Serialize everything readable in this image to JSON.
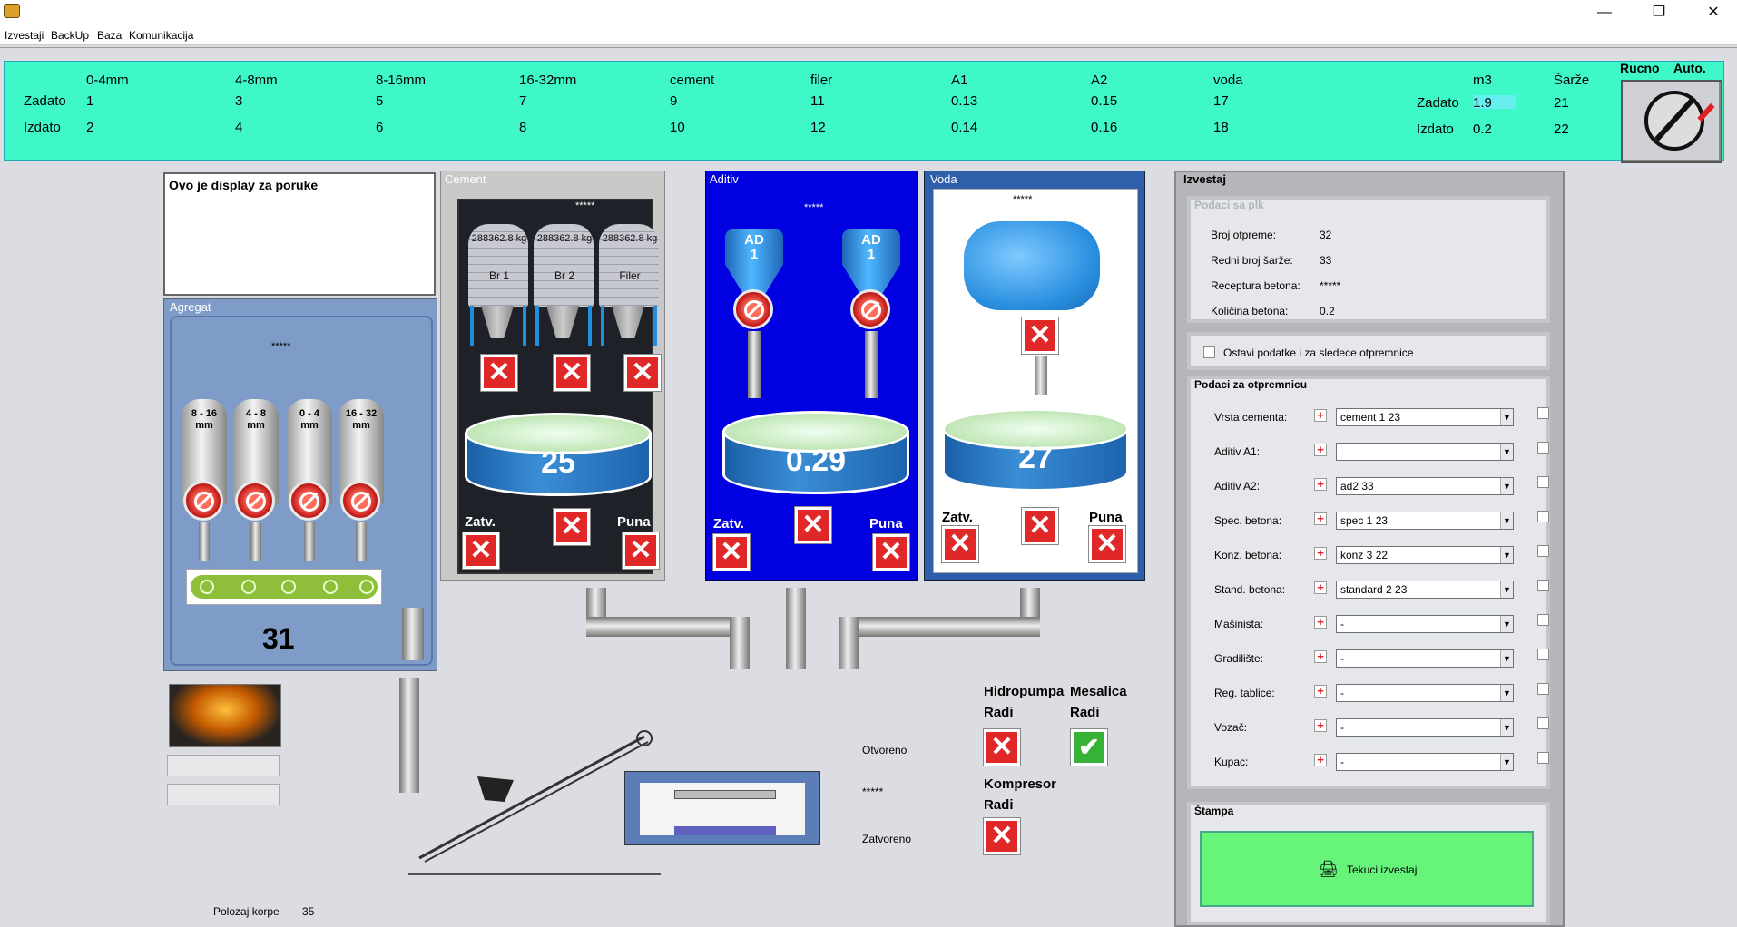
{
  "window": {
    "minimize": "—",
    "maximize": "❐",
    "close": "✕"
  },
  "menu": [
    "Izvestaji",
    "BackUp",
    "Baza",
    "Komunikacija"
  ],
  "top": {
    "columns": [
      "0-4mm",
      "4-8mm",
      "8-16mm",
      "16-32mm",
      "cement",
      "filer",
      "A1",
      "A2",
      "voda"
    ],
    "row_labels": {
      "zadato": "Zadato",
      "izdato": "Izdato"
    },
    "zadato": [
      "1",
      "3",
      "5",
      "7",
      "9",
      "11",
      "0.13",
      "0.15",
      "17"
    ],
    "izdato": [
      "2",
      "4",
      "6",
      "8",
      "10",
      "12",
      "0.14",
      "0.16",
      "18"
    ],
    "m3_label": "m3",
    "sarze_label": "Šarže",
    "m3_zadato": "1.9",
    "m3_izdato": "0.2",
    "sarze_zadato": "21",
    "sarze_izdato": "22",
    "ruc": "Rucno",
    "aut": "Auto."
  },
  "message": "Ovo je display za  poruke",
  "agregat": {
    "title": "Agregat",
    "stars": "*****",
    "silos": [
      "8 - 16\nmm",
      "4 - 8\nmm",
      "0 - 4\nmm",
      "16 - 32\nmm"
    ],
    "count": "31"
  },
  "cement": {
    "title": "Cement",
    "stars": "*****",
    "silos": [
      {
        "kg": "288362.8 kg",
        "name": "Br 1"
      },
      {
        "kg": "288362.8 kg",
        "name": "Br 2"
      },
      {
        "kg": "288362.8 kg",
        "name": "Filer"
      }
    ],
    "value": "25",
    "zatv": "Zatv.",
    "puna": "Puna"
  },
  "aditiv": {
    "title": "Aditiv",
    "stars": "*****",
    "ad1": "AD\n1",
    "ad2": "AD\n1",
    "value": "0.29",
    "zatv": "Zatv.",
    "puna": "Puna"
  },
  "voda": {
    "title": "Voda",
    "stars": "*****",
    "value": "27",
    "zatv": "Zatv.",
    "puna": "Puna"
  },
  "mixer": {
    "otvoreno": "Otvoreno",
    "stars": "*****",
    "zatvoreno": "Zatvoreno"
  },
  "status": {
    "hidropumpa": "Hidropumpa",
    "mesalica": "Mesalica",
    "radi1": "Radi",
    "radi2": "Radi",
    "kompresor": "Kompresor",
    "radi3": "Radi"
  },
  "polozaj": {
    "label": "Polozaj korpe",
    "value": "35"
  },
  "izvestaj": {
    "title": "Izvestaj",
    "plc_title": "Podaci sa plk",
    "plc": [
      {
        "k": "Broj otpreme:",
        "v": "32"
      },
      {
        "k": "Redni broj šarže:",
        "v": "33"
      },
      {
        "k": "Receptura betona:",
        "v": "*****"
      },
      {
        "k": "Količina betona:",
        "v": "0.2"
      }
    ],
    "keep_label": "Ostavi podatke i za sledece otpremnice",
    "otp_title": "Podaci za otpremnicu",
    "rows": [
      {
        "label": "Vrsta cementa:",
        "value": "cement 1 23"
      },
      {
        "label": "Aditiv A1:",
        "value": ""
      },
      {
        "label": "Aditiv A2:",
        "value": "ad2 33"
      },
      {
        "label": "Spec. betona:",
        "value": "spec 1 23"
      },
      {
        "label": "Konz. betona:",
        "value": "konz 3 22"
      },
      {
        "label": "Stand. betona:",
        "value": "standard 2 23"
      },
      {
        "label": "Mašinista:",
        "value": "-"
      },
      {
        "label": "Gradilište:",
        "value": "-"
      },
      {
        "label": "Reg. tablice:",
        "value": "-"
      },
      {
        "label": "Vozač:",
        "value": "-"
      },
      {
        "label": "Kupac:",
        "value": "-"
      }
    ],
    "stampa_title": "Štampa",
    "stampa_button": "Tekuci izvestaj"
  }
}
